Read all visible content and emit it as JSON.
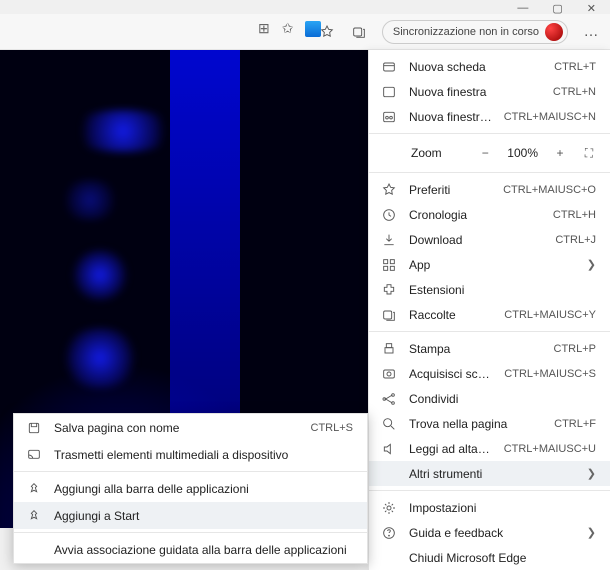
{
  "window": {
    "min": "—",
    "max": "▢",
    "close": "✕"
  },
  "toolbar": {
    "sync_label": "Sincronizzazione non in corso",
    "more_label": "…"
  },
  "zoom": {
    "label": "Zoom",
    "value": "100%"
  },
  "menu": {
    "new_tab": {
      "label": "Nuova scheda",
      "shortcut": "CTRL+T"
    },
    "new_window": {
      "label": "Nuova finestra",
      "shortcut": "CTRL+N"
    },
    "new_inprivate": {
      "label": "Nuova finestra InPrivate",
      "shortcut": "CTRL+MAIUSC+N"
    },
    "favorites": {
      "label": "Preferiti",
      "shortcut": "CTRL+MAIUSC+O"
    },
    "history": {
      "label": "Cronologia",
      "shortcut": "CTRL+H"
    },
    "downloads": {
      "label": "Download",
      "shortcut": "CTRL+J"
    },
    "apps": {
      "label": "App"
    },
    "extensions": {
      "label": "Estensioni"
    },
    "collections": {
      "label": "Raccolte",
      "shortcut": "CTRL+MAIUSC+Y"
    },
    "print": {
      "label": "Stampa",
      "shortcut": "CTRL+P"
    },
    "webcapture": {
      "label": "Acquisisci schermata Web",
      "shortcut": "CTRL+MAIUSC+S"
    },
    "share": {
      "label": "Condividi"
    },
    "find": {
      "label": "Trova nella pagina",
      "shortcut": "CTRL+F"
    },
    "readaloud": {
      "label": "Leggi ad alta voce",
      "shortcut": "CTRL+MAIUSC+U"
    },
    "moretools": {
      "label": "Altri strumenti"
    },
    "settings": {
      "label": "Impostazioni"
    },
    "help": {
      "label": "Guida e feedback"
    },
    "close_edge": {
      "label": "Chiudi Microsoft Edge"
    }
  },
  "submenu": {
    "save_as": {
      "label": "Salva pagina con nome",
      "shortcut": "CTRL+S"
    },
    "cast": {
      "label": "Trasmetti elementi multimediali a dispositivo"
    },
    "pin_taskbar": {
      "label": "Aggiungi alla barra delle applicazioni"
    },
    "pin_start": {
      "label": "Aggiungi a Start"
    },
    "app_assoc": {
      "label": "Avvia associazione guidata alla barra delle applicazioni"
    }
  }
}
